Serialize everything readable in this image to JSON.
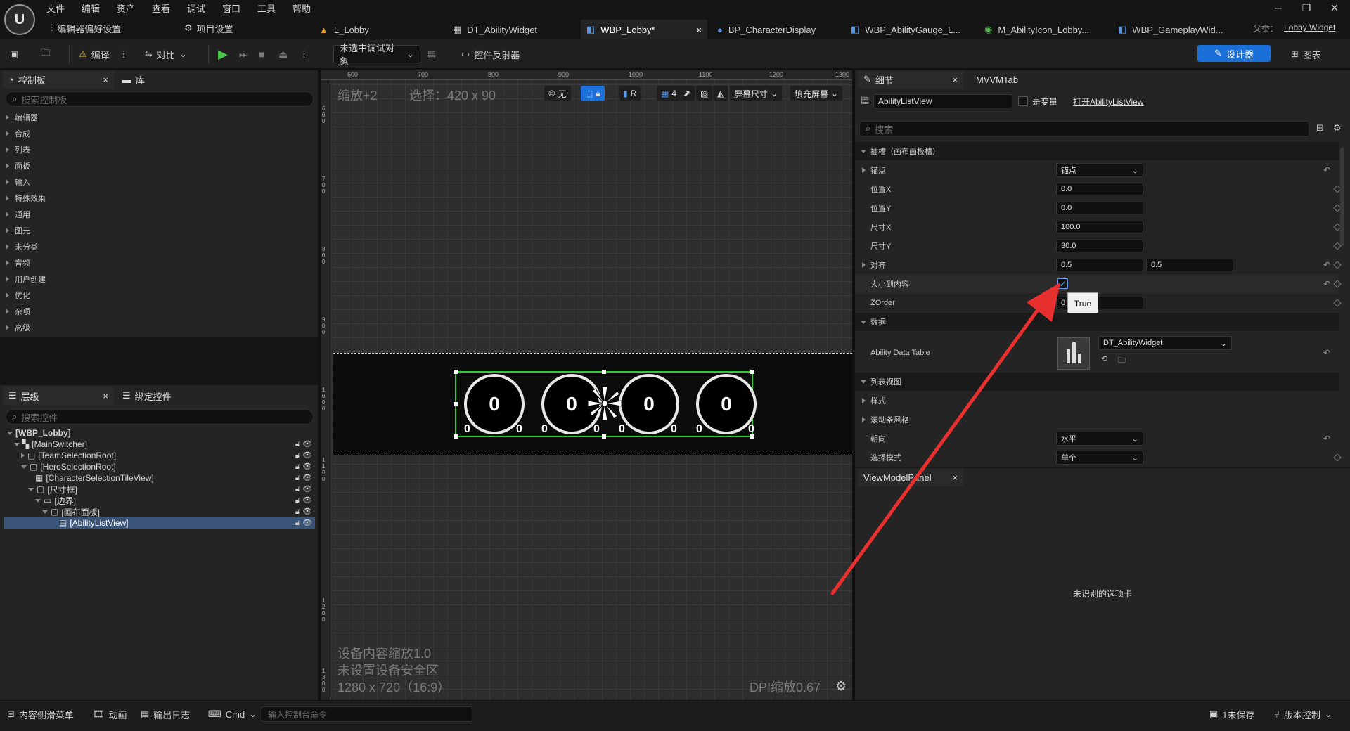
{
  "menu": [
    "文件",
    "编辑",
    "资产",
    "查看",
    "调试",
    "窗口",
    "工具",
    "帮助"
  ],
  "quick_settings": {
    "editor_prefs": "编辑器偏好设置",
    "project_settings": "项目设置"
  },
  "tabs": [
    {
      "label": "L_Lobby",
      "active": false
    },
    {
      "label": "DT_AbilityWidget",
      "active": false
    },
    {
      "label": "WBP_Lobby*",
      "active": true
    },
    {
      "label": "BP_CharacterDisplay",
      "active": false
    },
    {
      "label": "WBP_AbilityGauge_L...",
      "active": false
    },
    {
      "label": "M_AbilityIcon_Lobby...",
      "active": false
    },
    {
      "label": "WBP_GameplayWid...",
      "active": false
    }
  ],
  "parent": {
    "label": "父类：",
    "value": "Lobby Widget"
  },
  "toolbar": {
    "compile": "编译",
    "diff": "对比",
    "debug_object": "未选中调试对象",
    "widget_reflector": "控件反射器",
    "designer": "设计器",
    "graph": "图表"
  },
  "palette": {
    "tab_palette": "控制板",
    "tab_library": "库",
    "search_placeholder": "搜索控制板",
    "categories": [
      "编辑器",
      "合成",
      "列表",
      "面板",
      "输入",
      "特殊效果",
      "通用",
      "图元",
      "未分类",
      "音频",
      "用户创建",
      "优化",
      "杂项",
      "高级"
    ]
  },
  "hierarchy": {
    "tab_hierarchy": "层级",
    "tab_bind": "绑定控件",
    "search_placeholder": "搜索控件",
    "items": [
      {
        "label": "[WBP_Lobby]",
        "level": 0
      },
      {
        "label": "[MainSwitcher]",
        "level": 1
      },
      {
        "label": "[TeamSelectionRoot]",
        "level": 2
      },
      {
        "label": "[HeroSelectionRoot]",
        "level": 2
      },
      {
        "label": "[CharacterSelectionTileView]",
        "level": 3
      },
      {
        "label": "[尺寸框]",
        "level": 3
      },
      {
        "label": "[边界]",
        "level": 4
      },
      {
        "label": "[画布面板]",
        "level": 5
      },
      {
        "label": "[AbilityListView]",
        "level": 6,
        "selected": true
      }
    ]
  },
  "canvas": {
    "zoom": "缩放+2",
    "selection": "选择：420 x 90",
    "ruler_top": [
      "600",
      "700",
      "800",
      "900",
      "1000",
      "1100",
      "1200",
      "1300"
    ],
    "ruler_left": [
      "600",
      "700",
      "800",
      "900",
      "1000",
      "1100",
      "1200",
      "1300"
    ],
    "overlay_none": "无",
    "overlay_r": "R",
    "overlay_grid_count": "4",
    "screen_size": "屏幕尺寸",
    "fill_screen": "填充屏幕",
    "device_scale": "设备内容缩放1.0",
    "safe_zone": "未设置设备安全区",
    "resolution": "1280 x 720（16:9）",
    "dpi": "DPI缩放0.67",
    "ability_icons": [
      {
        "value": "0",
        "left": "0",
        "right": "0"
      },
      {
        "value": "0",
        "left": "0",
        "right": "0"
      },
      {
        "value": "0",
        "left": "0",
        "right": "0"
      },
      {
        "value": "0",
        "left": "0",
        "right": "0"
      }
    ]
  },
  "details": {
    "tab_details": "细节",
    "tab_mvvm": "MVVMTab",
    "widget_name": "AbilityListView",
    "is_variable": "是变量",
    "open_link": "打开AbilityListView",
    "search_placeholder": "搜索",
    "slot_section": "插槽（画布面板槽）",
    "anchors_label": "锚点",
    "anchors_value": "锚点",
    "pos_x_label": "位置X",
    "pos_x": "0.0",
    "pos_y_label": "位置Y",
    "pos_y": "0.0",
    "size_x_label": "尺寸X",
    "size_x": "100.0",
    "size_y_label": "尺寸Y",
    "size_y": "30.0",
    "align_label": "对齐",
    "align_x": "0.5",
    "align_y": "0.5",
    "size_to_content_label": "大小到内容",
    "tooltip": "True",
    "zorder_label": "ZOrder",
    "zorder": "0",
    "data_section": "数据",
    "ability_table_label": "Ability Data Table",
    "ability_table_value": "DT_AbilityWidget",
    "listview_section": "列表视图",
    "style_label": "样式",
    "scrollbar_label": "滚动条风格",
    "orientation_label": "朝向",
    "orientation_value": "水平",
    "selection_mode_label": "选择模式",
    "selection_mode_value": "单个"
  },
  "viewmodel": {
    "tab": "ViewModelPanel",
    "message": "未识别的选项卡"
  },
  "statusbar": {
    "content_drawer": "内容侧滑菜单",
    "animation": "动画",
    "output_log": "输出日志",
    "cmd": "Cmd",
    "console_placeholder": "输入控制台命令",
    "unsaved": "1未保存",
    "version_control": "版本控制"
  },
  "colors": {
    "accent": "#1a6fd8",
    "selection_green": "#2ecc2e",
    "annotation_arrow": "#e8302e"
  }
}
